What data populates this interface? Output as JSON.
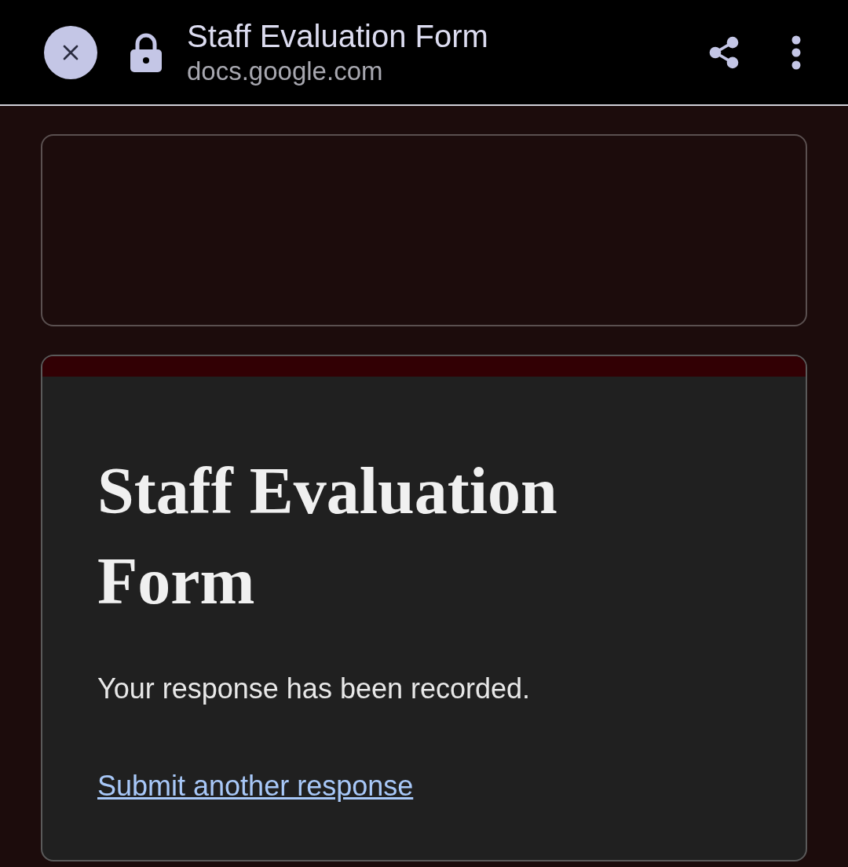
{
  "browser_bar": {
    "title": "Staff Evaluation Form",
    "url": "docs.google.com"
  },
  "form": {
    "title": "Staff Evaluation Form",
    "confirmation": "Your response has been recorded.",
    "link": "Submit another response"
  }
}
